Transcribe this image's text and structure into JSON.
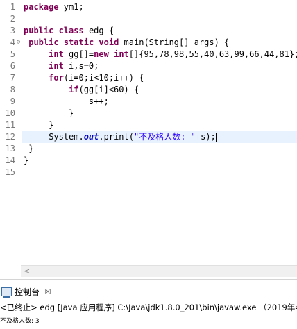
{
  "editor": {
    "line_numbers": [
      "1",
      "2",
      "3",
      "4",
      "5",
      "6",
      "7",
      "8",
      "9",
      "10",
      "11",
      "12",
      "13",
      "14",
      "15"
    ],
    "lines": [
      [
        {
          "t": "package",
          "c": "kw"
        },
        {
          "t": " ym1;",
          "c": ""
        }
      ],
      [],
      [
        {
          "t": "public",
          "c": "kw"
        },
        {
          "t": " ",
          "c": ""
        },
        {
          "t": "class",
          "c": "kw"
        },
        {
          "t": " edg {",
          "c": ""
        }
      ],
      [
        {
          "t": " ",
          "c": ""
        },
        {
          "t": "public",
          "c": "kw"
        },
        {
          "t": " ",
          "c": ""
        },
        {
          "t": "static",
          "c": "kw"
        },
        {
          "t": " ",
          "c": ""
        },
        {
          "t": "void",
          "c": "kw"
        },
        {
          "t": " main(String[] args) {",
          "c": ""
        }
      ],
      [
        {
          "t": "     ",
          "c": ""
        },
        {
          "t": "int",
          "c": "kw"
        },
        {
          "t": " gg[]=",
          "c": ""
        },
        {
          "t": "new",
          "c": "kw"
        },
        {
          "t": " ",
          "c": ""
        },
        {
          "t": "int",
          "c": "kw"
        },
        {
          "t": "[]{95,78,98,55,40,63,99,66,44,81};",
          "c": ""
        }
      ],
      [
        {
          "t": "     ",
          "c": ""
        },
        {
          "t": "int",
          "c": "kw"
        },
        {
          "t": " i,s=0;",
          "c": ""
        }
      ],
      [
        {
          "t": "     ",
          "c": ""
        },
        {
          "t": "for",
          "c": "kw"
        },
        {
          "t": "(i=0;i<10;i++) {",
          "c": ""
        }
      ],
      [
        {
          "t": "         ",
          "c": ""
        },
        {
          "t": "if",
          "c": "kw"
        },
        {
          "t": "(gg[i]<60) {",
          "c": ""
        }
      ],
      [
        {
          "t": "             s++;",
          "c": ""
        }
      ],
      [
        {
          "t": "         }",
          "c": ""
        }
      ],
      [
        {
          "t": "     }",
          "c": ""
        }
      ],
      [
        {
          "t": "     System.",
          "c": ""
        },
        {
          "t": "out",
          "c": "fld"
        },
        {
          "t": ".print(",
          "c": ""
        },
        {
          "t": "\"不及格人数: \"",
          "c": "str"
        },
        {
          "t": "+s);",
          "c": ""
        }
      ],
      [
        {
          "t": " }",
          "c": ""
        }
      ],
      [
        {
          "t": "}",
          "c": ""
        }
      ],
      []
    ],
    "current_line_index": 11,
    "fold_marker_line_index": 3
  },
  "scrollbar": {
    "left_arrow": "<"
  },
  "console": {
    "tab_label": "控制台",
    "tab_close": "☒",
    "status": "<已终止> edg [Java 应用程序] C:\\Java\\jdk1.8.0_201\\bin\\javaw.exe （2019年4",
    "output": "不及格人数: 3"
  }
}
